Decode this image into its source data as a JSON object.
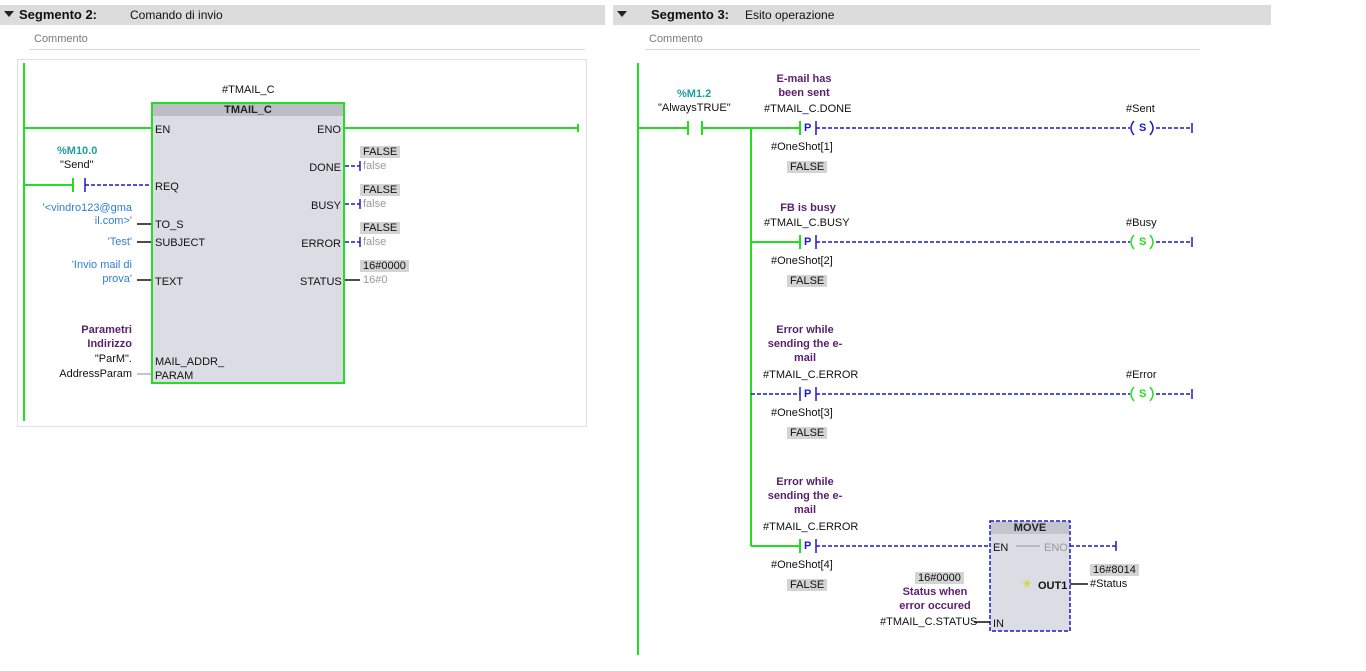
{
  "seg2": {
    "title": "Segmento 2:",
    "desc": "Comando di invio",
    "comment": "Commento",
    "instance": "#TMAIL_C",
    "block_name": "TMAIL_C",
    "contact_addr": "%M10.0",
    "contact_tag": "\"Send\"",
    "inputs": {
      "en": "EN",
      "req": "REQ",
      "to_s": "TO_S",
      "subject": "SUBJECT",
      "text": "TEXT",
      "mail_param_1": "MAIL_ADDR_",
      "mail_param_2": "PARAM"
    },
    "outputs": {
      "eno": "ENO",
      "done": "DONE",
      "busy": "BUSY",
      "error": "ERROR",
      "status": "STATUS"
    },
    "to_value_1": "'<vindro123@gma",
    "to_value_2": "il.com>'",
    "subject_value": "'Test'",
    "text_value_1": "'Invio mail di",
    "text_value_2": "prova'",
    "param_comment_1": "Parametri",
    "param_comment_2": "Indirizzo",
    "param_tag_1": "\"ParM\".",
    "param_tag_2": "AddressParam",
    "done_monitor": "FALSE",
    "done_value": "false",
    "busy_monitor": "FALSE",
    "busy_value": "false",
    "error_monitor": "FALSE",
    "error_value": "false",
    "status_monitor": "16#0000",
    "status_value": "16#0"
  },
  "seg3": {
    "title": "Segmento 3:",
    "desc": "Esito operazione",
    "comment": "Commento",
    "contact_addr": "%M1.2",
    "contact_tag": "\"AlwaysTRUE\"",
    "rung1": {
      "comment_1": "E-mail has",
      "comment_2": "been sent",
      "operand": "#TMAIL_C.DONE",
      "oneshot": "#OneShot[1]",
      "oneshot_value": "FALSE",
      "coil": "#Sent",
      "coil_letter": "S"
    },
    "rung2": {
      "comment_1": "FB is busy",
      "operand": "#TMAIL_C.BUSY",
      "oneshot": "#OneShot[2]",
      "oneshot_value": "FALSE",
      "coil": "#Busy",
      "coil_letter": "S"
    },
    "rung3": {
      "comment_1": "Error while",
      "comment_2": "sending the e-",
      "comment_3": "mail",
      "operand": "#TMAIL_C.ERROR",
      "oneshot": "#OneShot[3]",
      "oneshot_value": "FALSE",
      "coil": "#Error",
      "coil_letter": "S"
    },
    "rung4": {
      "comment_1": "Error while",
      "comment_2": "sending the e-",
      "comment_3": "mail",
      "operand": "#TMAIL_C.ERROR",
      "oneshot": "#OneShot[4]",
      "oneshot_value": "FALSE"
    },
    "pcontact": "P",
    "move": {
      "title": "MOVE",
      "en": "EN",
      "eno": "ENO",
      "in": "IN",
      "out": "OUT1",
      "in_monitor": "16#0000",
      "in_comment_1": "Status when",
      "in_comment_2": "error occured",
      "in_operand": "#TMAIL_C.STATUS",
      "out_monitor": "16#8014",
      "out_operand": "#Status"
    }
  },
  "colors": {
    "power": "#22dd22",
    "unpowered": "#1a1acc",
    "header": "#dcdcdc"
  }
}
